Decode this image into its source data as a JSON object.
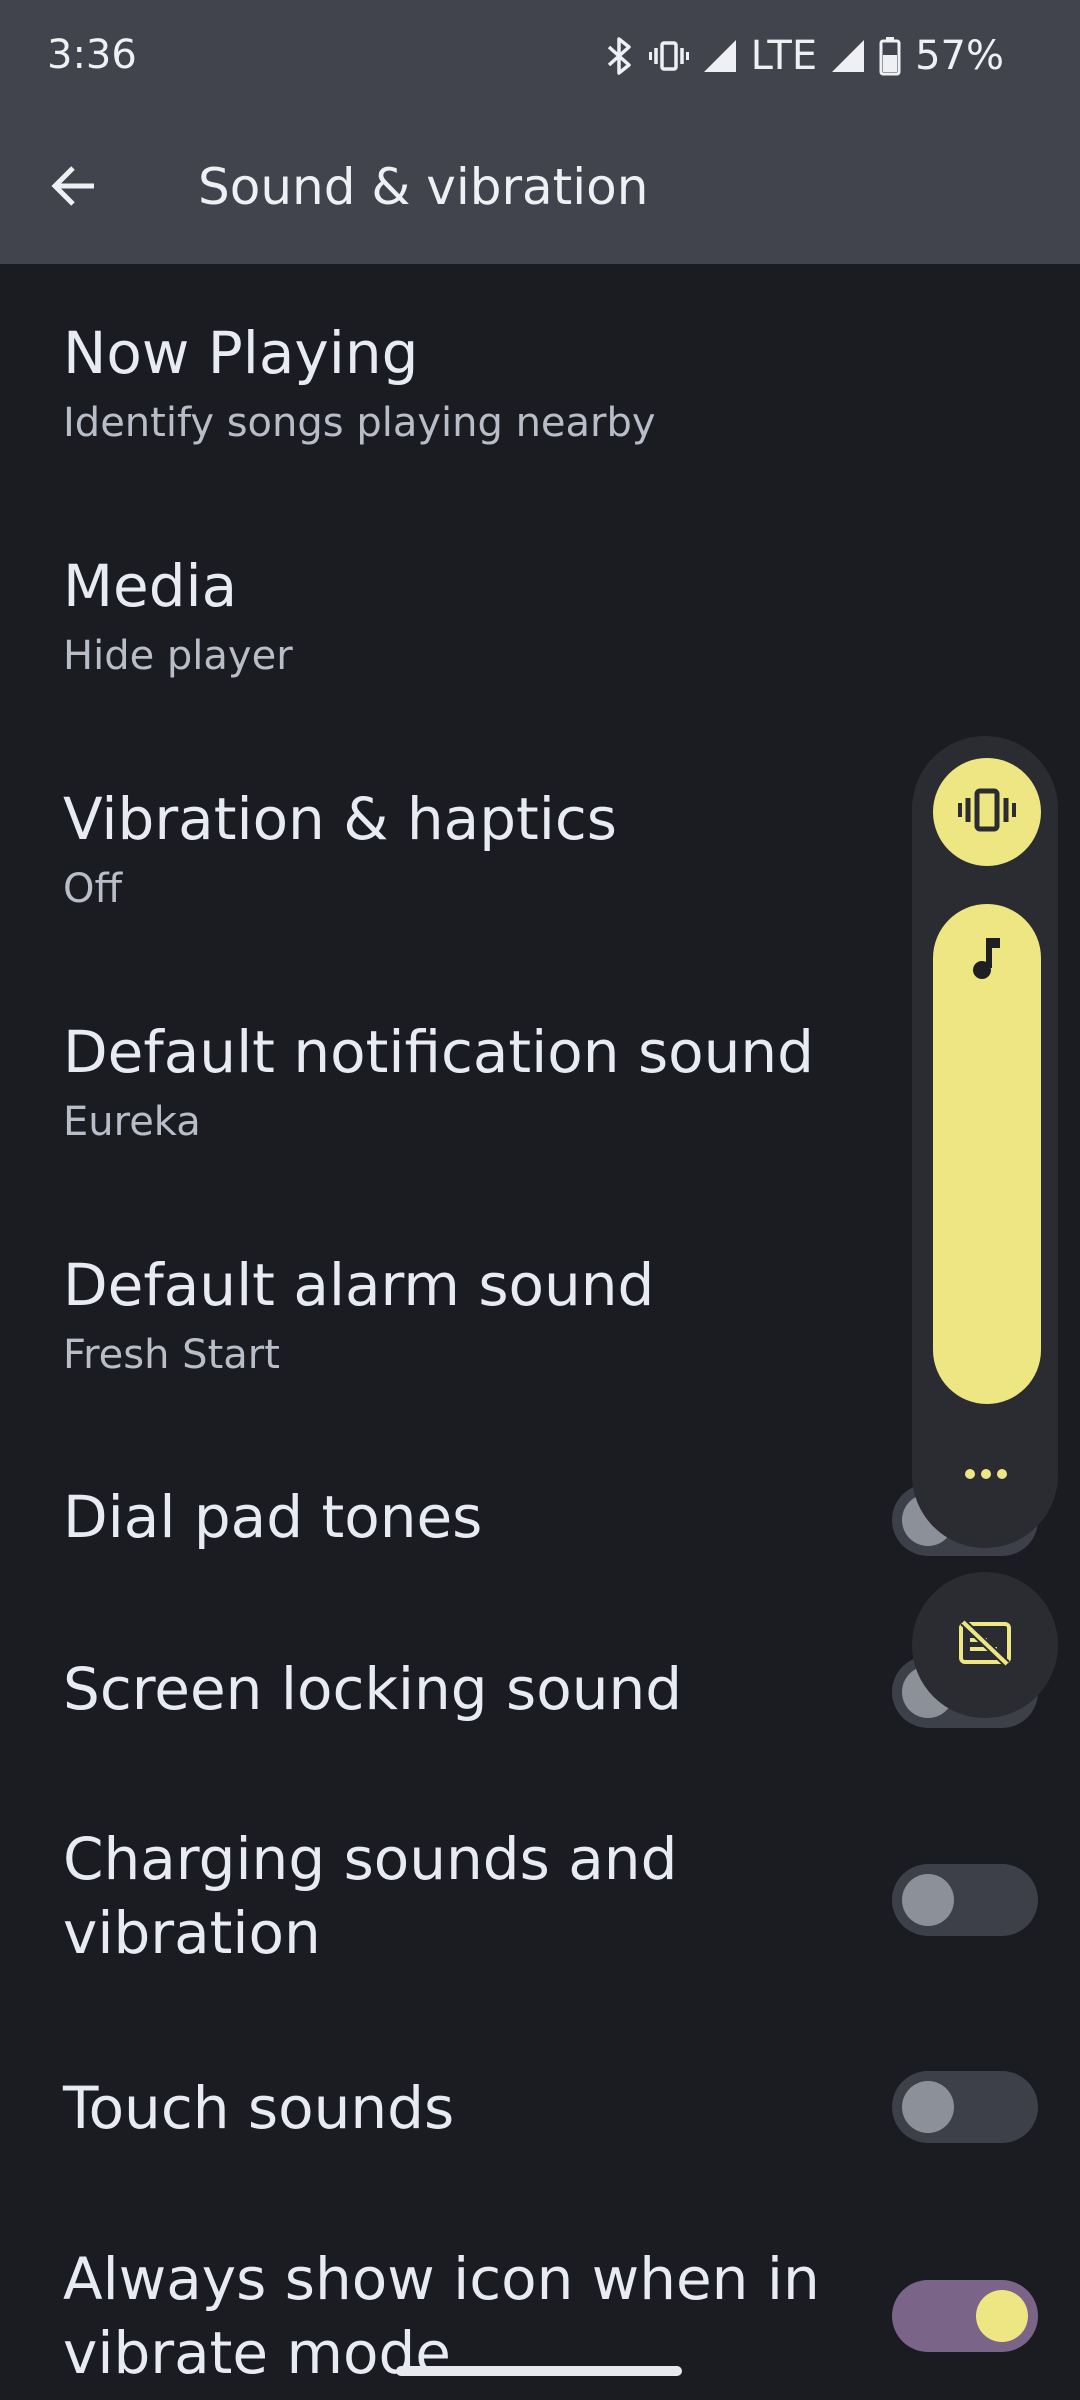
{
  "status_bar": {
    "time": "3:36",
    "network": "LTE",
    "battery": "57%",
    "icons": [
      "bluetooth-icon",
      "vibrate-icon",
      "signal-icon",
      "signal-icon",
      "battery-icon"
    ]
  },
  "app_bar": {
    "back_icon": "arrow-back-icon",
    "title": "Sound & vibration"
  },
  "settings": [
    {
      "title": "Now Playing",
      "subtitle": "Identify songs playing nearby"
    },
    {
      "title": "Media",
      "subtitle": "Hide player"
    },
    {
      "title": "Vibration & haptics",
      "subtitle": "Off"
    },
    {
      "title": "Default notification sound",
      "subtitle": "Eureka"
    },
    {
      "title": "Default alarm sound",
      "subtitle": "Fresh Start"
    },
    {
      "title": "Dial pad tones",
      "toggle": false
    },
    {
      "title": "Screen locking sound",
      "toggle": false
    },
    {
      "title_line1": "Charging sounds and",
      "title_line2": "vibration",
      "toggle": false
    },
    {
      "title": "Touch sounds",
      "toggle": false
    },
    {
      "title_line1": "Always show icon when in",
      "title_line2": "vibrate mode",
      "toggle": true
    }
  ],
  "volume_panel": {
    "ringer_mode_icon": "vibrate-icon",
    "stream_icon": "music-note-icon",
    "level": 1.0,
    "more_icon": "more-horiz-icon",
    "caption_icon": "captions-off-icon"
  },
  "colors": {
    "accent": "#ede682",
    "toggle_on_track": "#7a6487",
    "background": "#1a1c22",
    "app_bar": "#41444c"
  }
}
